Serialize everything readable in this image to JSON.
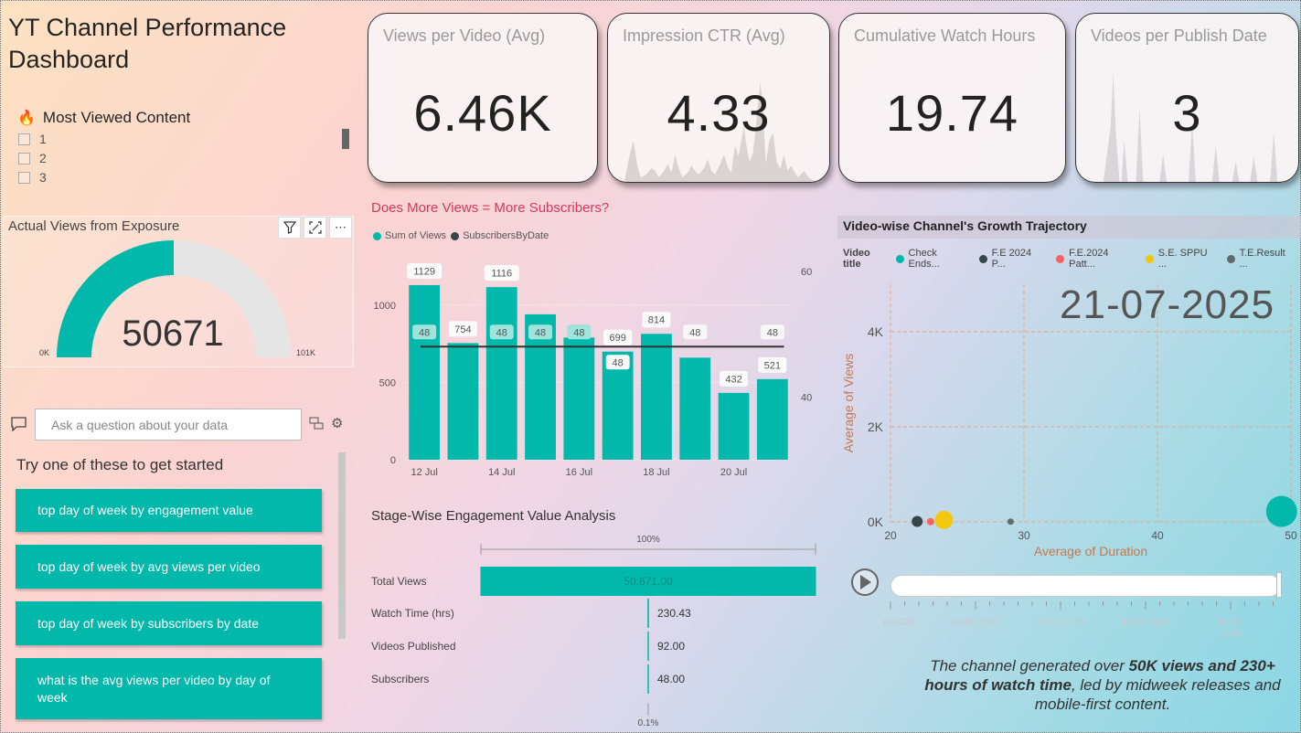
{
  "dashboard": {
    "title": "YT Channel Performance Dashboard"
  },
  "slicer": {
    "icon": "fire-icon",
    "header": "Most Viewed Content",
    "items": [
      "1",
      "2",
      "3"
    ]
  },
  "cards": [
    {
      "title": "Views per Video (Avg)",
      "value": "6.46K"
    },
    {
      "title": "Impression CTR (Avg)",
      "value": "4.33"
    },
    {
      "title": "Cumulative Watch Hours",
      "value": "19.74"
    },
    {
      "title": "Videos per Publish Date",
      "value": "3"
    }
  ],
  "gauge": {
    "title": "Actual Views from Exposure",
    "value": "50671",
    "min_label": "0K",
    "max_label": "101K",
    "value_num": 50671,
    "max_num": 101342,
    "fill": "#01b8aa",
    "track": "#e6e6e6"
  },
  "qa": {
    "placeholder": "Ask a question about your data",
    "prompt": "Try one of these to get started",
    "suggestions": [
      "top day of week by engagement value",
      "top day of week by avg views per video",
      "top day of week by subscribers by date",
      "what is the avg views per video by day of week"
    ]
  },
  "chart_data": [
    {
      "type": "bar",
      "title": "Does More Views = More Subscribers?",
      "categories": [
        "12 Jul",
        "13 Jul",
        "14 Jul",
        "15 Jul",
        "16 Jul",
        "17 Jul",
        "18 Jul",
        "19 Jul",
        "20 Jul",
        "21 Jul"
      ],
      "x_tick_labels": [
        "12 Jul",
        "14 Jul",
        "16 Jul",
        "18 Jul",
        "20 Jul"
      ],
      "series": [
        {
          "name": "Sum of Views",
          "kind": "bar",
          "color": "#01b8aa",
          "values": [
            1129,
            754,
            1116,
            940,
            790,
            699,
            814,
            660,
            432,
            521
          ],
          "data_labels": [
            "1129",
            "754",
            "1116",
            "",
            "",
            "699",
            "814",
            "",
            "432",
            "521"
          ]
        },
        {
          "name": "SubscribersByDate",
          "kind": "line",
          "color": "#333333",
          "values": [
            48,
            48,
            48,
            48,
            48,
            48,
            48,
            48,
            48,
            48
          ],
          "data_labels": [
            "48",
            "",
            "48",
            "48",
            "48",
            "48",
            "",
            "48",
            "",
            "48"
          ]
        }
      ],
      "y_left": {
        "ticks": [
          "0",
          "500",
          "1000"
        ],
        "lim": [
          0,
          1300
        ]
      },
      "y_right": {
        "ticks": [
          "40",
          "60"
        ],
        "lim": [
          30,
          62
        ]
      },
      "legend": "top-left"
    },
    {
      "type": "bar",
      "orientation": "horizontal",
      "title": "Stage-Wise Engagement Value Analysis",
      "categories": [
        "Total Views",
        "Watch Time (hrs)",
        "Videos Published",
        "Subscribers"
      ],
      "values": [
        50671,
        230.43,
        92,
        48
      ],
      "value_labels": [
        "50,671.00",
        "230.43",
        "92.00",
        "48.00"
      ],
      "top_label": "100%",
      "bottom_label": "0.1%",
      "color": "#01b8aa"
    },
    {
      "type": "scatter",
      "title": "Video-wise Channel's Growth Trajectory",
      "legend_title": "Video title",
      "series": [
        {
          "name": "Check Ends...",
          "color": "#01b8aa",
          "points": [
            {
              "x": 49.3,
              "y": 220,
              "size": 34
            }
          ]
        },
        {
          "name": "F.E 2024 P...",
          "color": "#374649",
          "points": [
            {
              "x": 22,
              "y": 10,
              "size": 12
            }
          ]
        },
        {
          "name": "F.E.2024 Patt...",
          "color": "#fd625e",
          "points": [
            {
              "x": 23,
              "y": 5,
              "size": 8
            }
          ]
        },
        {
          "name": "S.E. SPPU ...",
          "color": "#f2c80f",
          "points": [
            {
              "x": 24,
              "y": 40,
              "size": 20
            }
          ]
        },
        {
          "name": "T.E.Result ...",
          "color": "#5f6b6d",
          "points": [
            {
              "x": 29,
              "y": 5,
              "size": 7
            }
          ]
        }
      ],
      "xlabel": "Average of Duration",
      "ylabel": "Average of Views",
      "x_ticks": [
        "20",
        "30",
        "40",
        "50"
      ],
      "y_ticks": [
        "0K",
        "2K",
        "4K"
      ],
      "xlim": [
        20,
        50
      ],
      "ylim": [
        0,
        5000
      ],
      "play_axis_value": "21-07-2025",
      "play_axis_ticks": [
        "24-06-2025",
        "30-06-2025",
        "06-07-2025",
        "12-07-2025",
        "18-07-2025"
      ]
    }
  ],
  "narrative": {
    "part1": "The channel generated over ",
    "bold1": "50K views and 230+ hours of watch time",
    "part2": ", led by midweek releases and mobile-first content."
  }
}
